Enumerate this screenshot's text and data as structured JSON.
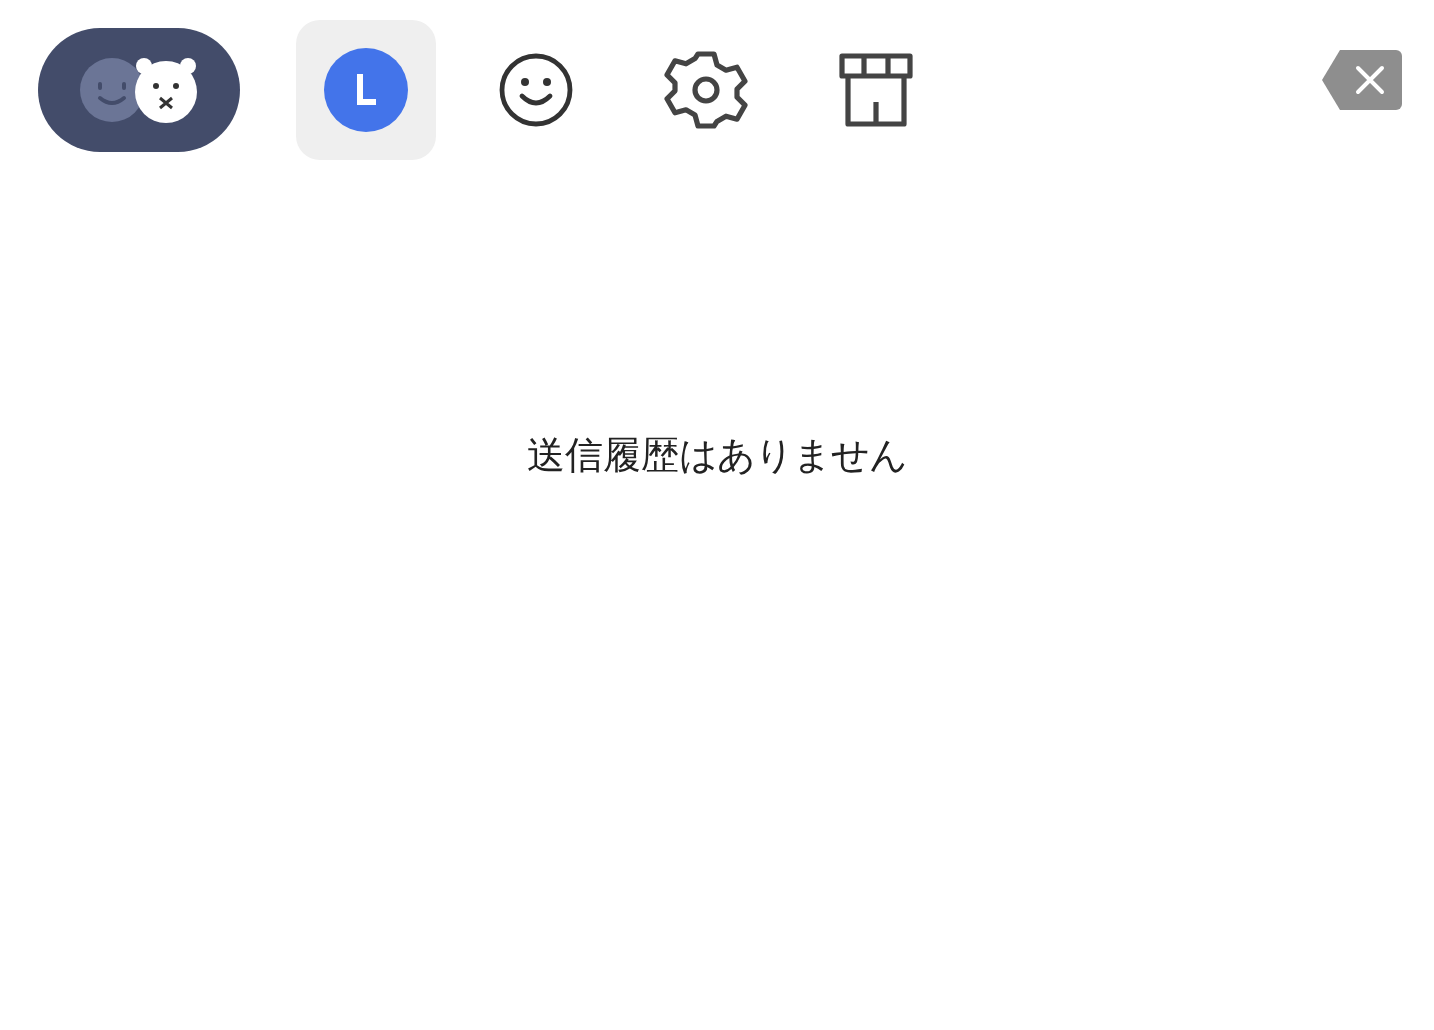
{
  "tabs": [
    {
      "kind": "stickers",
      "selected": false
    },
    {
      "kind": "history",
      "selected": true
    },
    {
      "kind": "emoji",
      "selected": false
    },
    {
      "kind": "settings",
      "selected": false
    },
    {
      "kind": "shop",
      "selected": false
    }
  ],
  "empty_message": "送信履歴はありません"
}
